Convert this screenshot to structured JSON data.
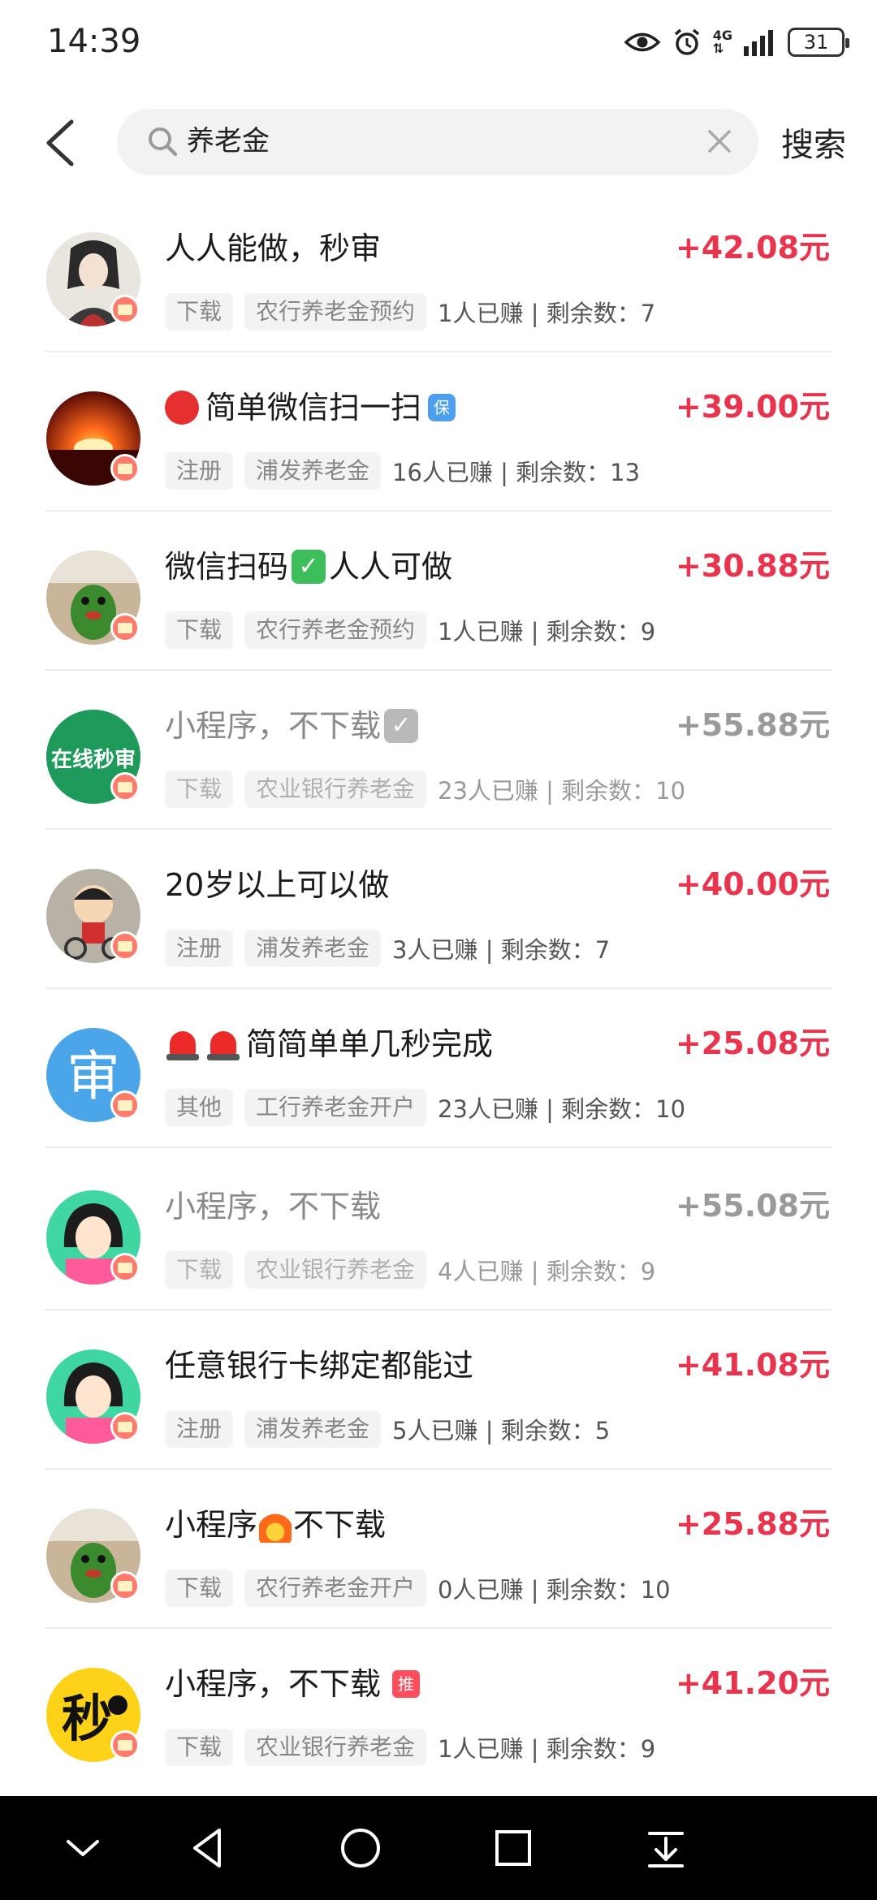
{
  "status_bar": {
    "time": "14:39",
    "network": "4G",
    "battery": "31"
  },
  "search": {
    "query": "养老金",
    "button_label": "搜索"
  },
  "items": [
    {
      "title": "人人能做，秒审",
      "price": "+42.08元",
      "tag1": "下载",
      "tag2": "农行养老金预约",
      "stats": "1人已赚 | 剩余数：7",
      "dim": false
    },
    {
      "title": "简单微信扫一扫",
      "price": "+39.00元",
      "tag1": "注册",
      "tag2": "浦发养老金",
      "stats": "16人已赚 | 剩余数：13",
      "dim": false
    },
    {
      "title_a": "微信扫码",
      "title_b": "人人可做",
      "price": "+30.88元",
      "tag1": "下载",
      "tag2": "农行养老金预约",
      "stats": "1人已赚 | 剩余数：9",
      "dim": false
    },
    {
      "title": "小程序，不下载",
      "price": "+55.88元",
      "tag1": "下载",
      "tag2": "农业银行养老金",
      "stats": "23人已赚 | 剩余数：10",
      "dim": true
    },
    {
      "title": "20岁以上可以做",
      "price": "+40.00元",
      "tag1": "注册",
      "tag2": "浦发养老金",
      "stats": "3人已赚 | 剩余数：7",
      "dim": false
    },
    {
      "title": "简简单单几秒完成",
      "price": "+25.08元",
      "tag1": "其他",
      "tag2": "工行养老金开户",
      "stats": "23人已赚 | 剩余数：10",
      "dim": false
    },
    {
      "title": "小程序，不下载",
      "price": "+55.08元",
      "tag1": "下载",
      "tag2": "农业银行养老金",
      "stats": "4人已赚 | 剩余数：9",
      "dim": true
    },
    {
      "title": "任意银行卡绑定都能过",
      "price": "+41.08元",
      "tag1": "注册",
      "tag2": "浦发养老金",
      "stats": "5人已赚 | 剩余数：5",
      "dim": false
    },
    {
      "title_a": "小程序",
      "title_b": "不下载",
      "price": "+25.88元",
      "tag1": "下载",
      "tag2": "农行养老金开户",
      "stats": "0人已赚 | 剩余数：10",
      "dim": false
    },
    {
      "title": "小程序，不下载",
      "price": "+41.20元",
      "tag1": "下载",
      "tag2": "农业银行养老金",
      "stats": "1人已赚 | 剩余数：9",
      "dim": false
    }
  ],
  "avatar_text": {
    "a4": "在线秒审",
    "a6": "审",
    "a10": "秒"
  },
  "emoji_text": {
    "shield": "保",
    "tui": "推",
    "check": "✓"
  }
}
